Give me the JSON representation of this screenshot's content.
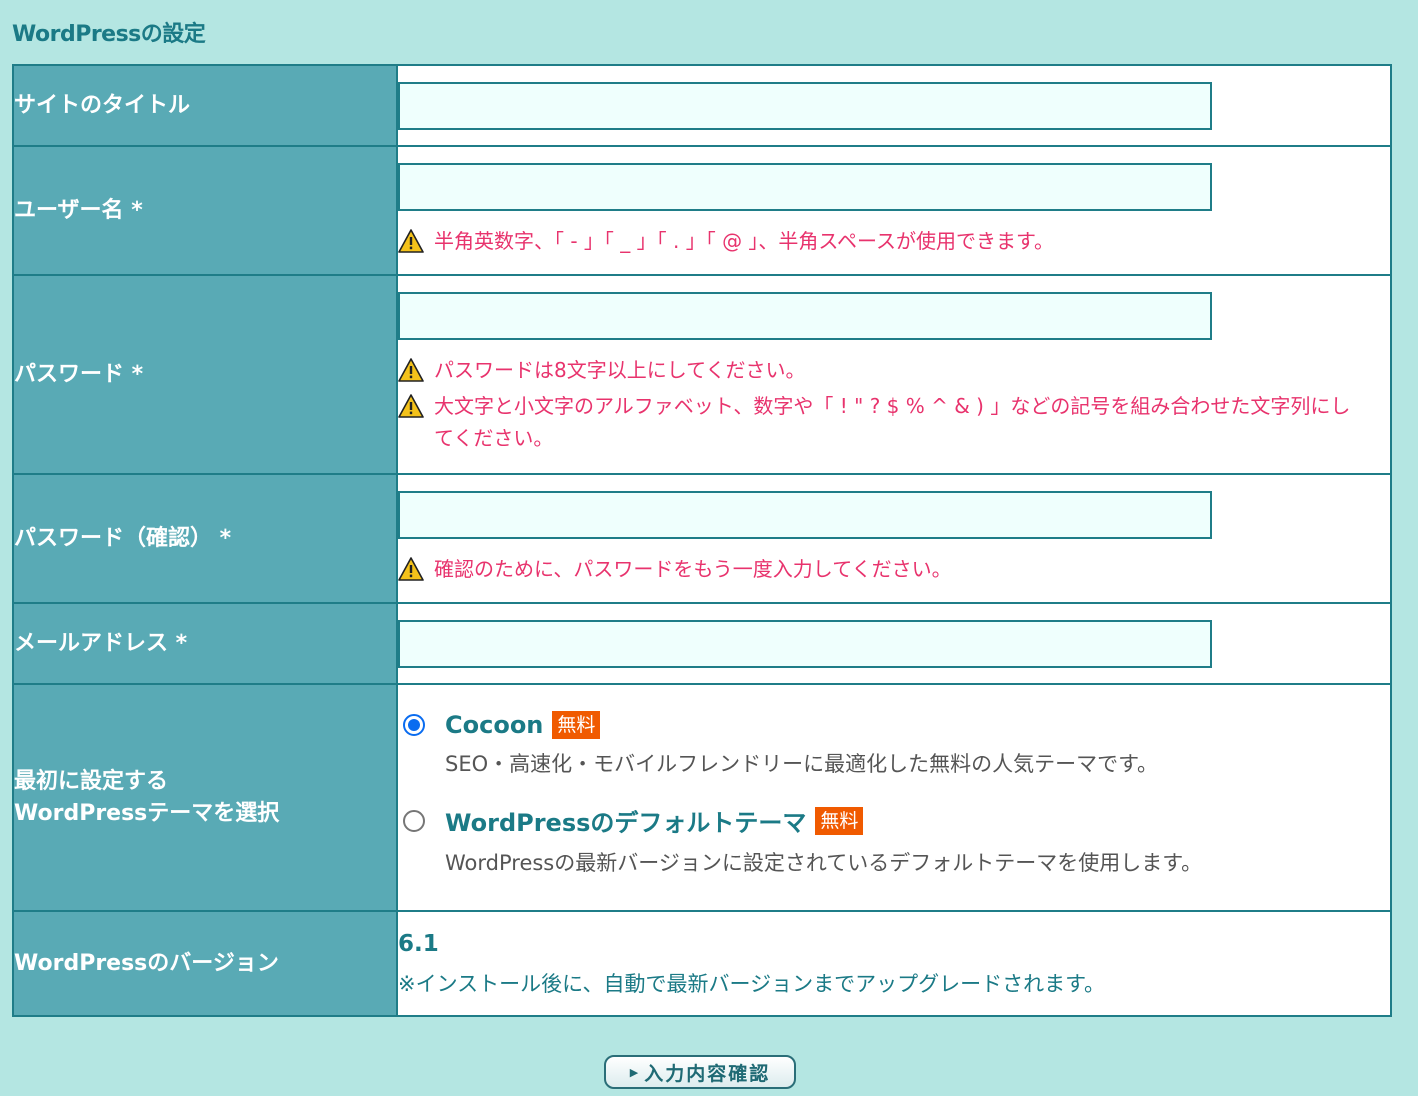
{
  "section_title": "WordPressの設定",
  "fields": {
    "site_title": {
      "label": "サイトのタイトル",
      "value": ""
    },
    "username": {
      "label": "ユーザー名 *",
      "value": "",
      "note": "半角英数字、「 - 」「 _ 」「 . 」「 @ 」、半角スペースが使用できます。"
    },
    "password": {
      "label": "パスワード *",
      "value": "",
      "notes": [
        "パスワードは8文字以上にしてください。",
        "大文字と小文字のアルファベット、数字や「 ! \" ? $ % ^ & ) 」などの記号を組み合わせた文字列にしてください。"
      ]
    },
    "password_confirm": {
      "label": "パスワード（確認） *",
      "value": "",
      "note": "確認のために、パスワードをもう一度入力してください。"
    },
    "email": {
      "label": "メールアドレス *",
      "value": ""
    }
  },
  "theme": {
    "label_line1": "最初に設定する",
    "label_line2": "WordPressテーマを選択",
    "options": [
      {
        "name": "Cocoon",
        "badge": "無料",
        "description": "SEO・高速化・モバイルフレンドリーに最適化した無料の人気テーマです。",
        "selected": true
      },
      {
        "name": "WordPressのデフォルトテーマ",
        "badge": "無料",
        "description": "WordPressの最新バージョンに設定されているデフォルトテーマを使用します。",
        "selected": false
      }
    ]
  },
  "version": {
    "label": "WordPressのバージョン",
    "value": "6.1",
    "note": "※インストール後に、自動で最新バージョンまでアップグレードされます。"
  },
  "confirm_button": {
    "label": "入力内容確認",
    "icon": "play-triangle-icon"
  },
  "icons": {
    "warning": "warning-triangle-icon"
  },
  "colors": {
    "background": "#b4e6e2",
    "label_bg": "#59aab5",
    "border": "#1f7d88",
    "accent_text": "#1b7a86",
    "warning_text": "#e8336d",
    "badge_bg": "#f05a00",
    "radio_selected": "#0a6cf0"
  }
}
